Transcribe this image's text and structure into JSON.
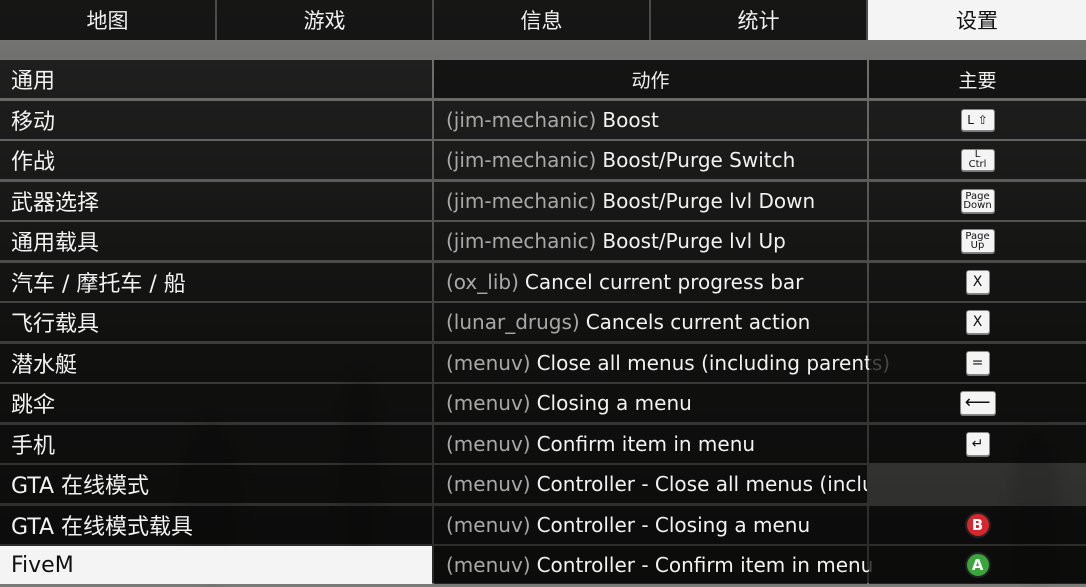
{
  "tabs": [
    {
      "label": "地图"
    },
    {
      "label": "游戏"
    },
    {
      "label": "信息"
    },
    {
      "label": "统计"
    },
    {
      "label": "设置"
    }
  ],
  "sidebar": {
    "items": [
      {
        "label": "通用"
      },
      {
        "label": "移动"
      },
      {
        "label": "作战"
      },
      {
        "label": "武器选择"
      },
      {
        "label": "通用载具"
      },
      {
        "label": "汽车 / 摩托车 / 船"
      },
      {
        "label": "飞行载具"
      },
      {
        "label": "潜水艇"
      },
      {
        "label": "跳伞"
      },
      {
        "label": "手机"
      },
      {
        "label": "GTA 在线模式"
      },
      {
        "label": "GTA 在线模式载具"
      },
      {
        "label": "FiveM"
      }
    ]
  },
  "headers": {
    "action": "动作",
    "primary": "主要"
  },
  "bindings": [
    {
      "resource": "(jim-mechanic)",
      "action": "Boost",
      "key": "L ⇧"
    },
    {
      "resource": "(jim-mechanic)",
      "action": "Boost/Purge Switch",
      "key": "L Ctrl"
    },
    {
      "resource": "(jim-mechanic)",
      "action": "Boost/Purge lvl Down",
      "key": "Page Down"
    },
    {
      "resource": "(jim-mechanic)",
      "action": "Boost/Purge lvl Up",
      "key": "Page Up"
    },
    {
      "resource": "(ox_lib)",
      "action": "Cancel current progress bar",
      "key": "X"
    },
    {
      "resource": "(lunar_drugs)",
      "action": "Cancels current action",
      "key": "X"
    },
    {
      "resource": "(menuv)",
      "action": "Close all menus (including parents)",
      "key": "="
    },
    {
      "resource": "(menuv)",
      "action": "Closing a menu",
      "key": "⟵"
    },
    {
      "resource": "(menuv)",
      "action": "Confirm item in menu",
      "key": "↵"
    },
    {
      "resource": "(menuv)",
      "action": "Controller - Close all menus (including parents)",
      "key": ""
    },
    {
      "resource": "(menuv)",
      "action": "Controller - Closing a menu",
      "key": "B"
    },
    {
      "resource": "(menuv)",
      "action": "Controller - Confirm item in menu",
      "key": "A"
    }
  ],
  "colors": {
    "b_button": "#d6262e",
    "a_button": "#3aa53a"
  }
}
